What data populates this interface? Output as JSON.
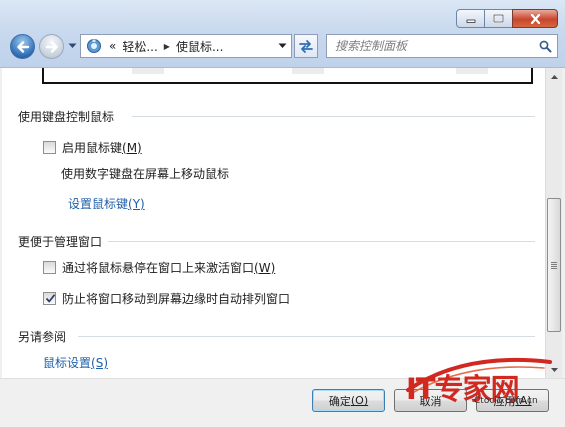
{
  "window": {
    "minimize_icon": "minimize-icon",
    "maximize_icon": "maximize-icon",
    "close_icon": "close-icon"
  },
  "nav": {
    "back_icon": "back-arrow-icon",
    "forward_icon": "forward-arrow-icon",
    "recent_icon": "chevron-down-icon"
  },
  "address": {
    "icon": "control-panel-icon",
    "overflow": "«",
    "crumbs": [
      "轻松...",
      "使鼠标..."
    ],
    "dropdown_icon": "chevron-down-icon"
  },
  "refresh_icon": "refresh-icon",
  "search": {
    "placeholder": "搜索控制面板",
    "value": "",
    "icon": "search-icon"
  },
  "sections": {
    "keyboard": {
      "title": "使用键盘控制鼠标",
      "checkbox": {
        "label": "启用鼠标键",
        "mnemonic": "(M)",
        "checked": false
      },
      "description": "使用数字键盘在屏幕上移动鼠标",
      "link": {
        "label": "设置鼠标键",
        "mnemonic": "(Y)"
      }
    },
    "windows": {
      "title": "更便于管理窗口",
      "option1": {
        "label": "通过将鼠标悬停在窗口上来激活窗口",
        "mnemonic": "(W)",
        "checked": false
      },
      "option2": {
        "label": "防止将窗口移动到屏幕边缘时自动排列窗口",
        "checked": true
      }
    },
    "see_also": {
      "title": "另请参阅",
      "link": {
        "label": "鼠标设置",
        "mnemonic": "(S)"
      }
    }
  },
  "footer": {
    "ok": {
      "label": "确定",
      "mnemonic": "(O)"
    },
    "cancel": {
      "label": "取消"
    },
    "apply": {
      "label": "应用",
      "mnemonic": "(A)"
    }
  },
  "watermark": {
    "text": "IT专家网",
    "sub": "Ctocio.com.cn"
  },
  "colors": {
    "link": "#1f5fa8",
    "watermark": "#d1281f",
    "chrome": "#c9d9ee"
  }
}
